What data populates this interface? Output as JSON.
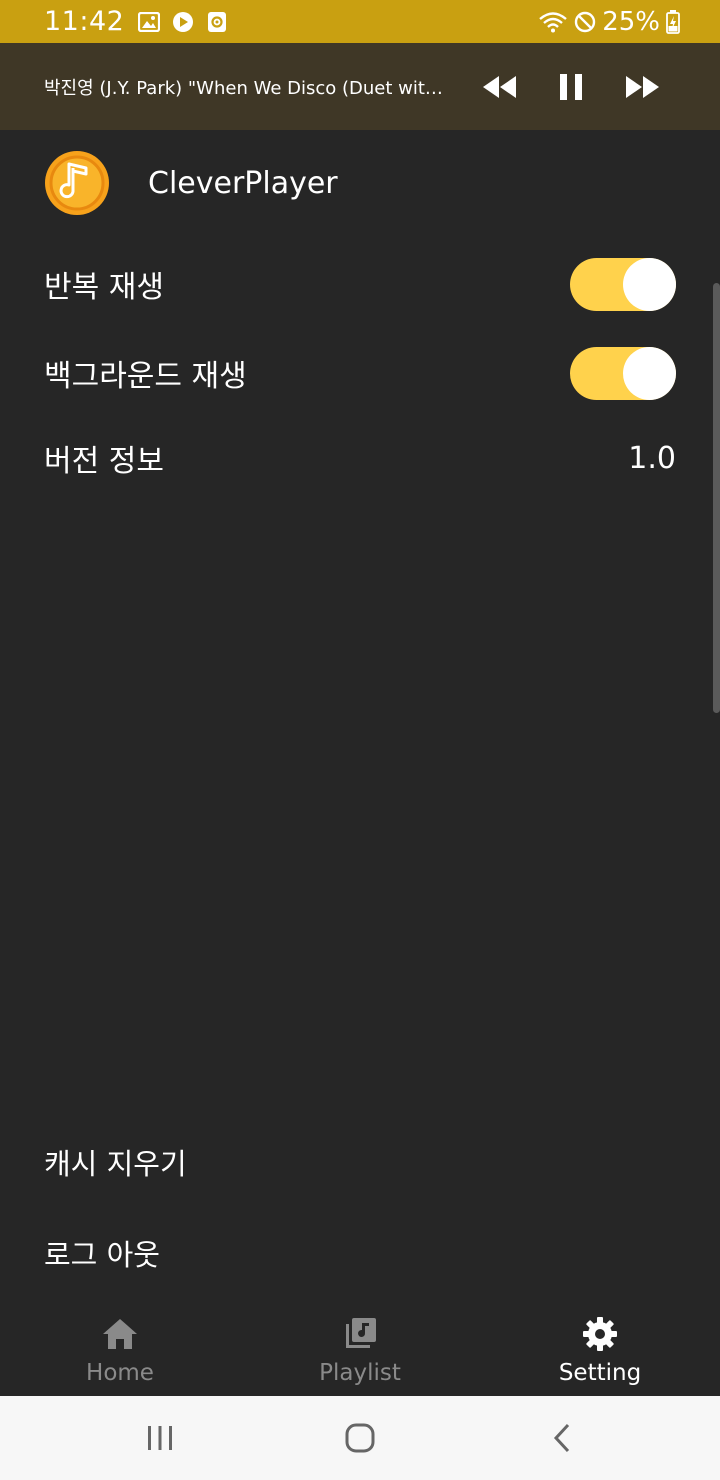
{
  "status_bar": {
    "time": "11:42",
    "battery_text": "25%",
    "background": "#c9a011"
  },
  "now_playing": {
    "title": "박진영 (J.Y. Park) \"When We Disco (Duet with Sunmi)\""
  },
  "header": {
    "app_name": "CleverPlayer"
  },
  "settings": {
    "repeat": {
      "label": "반복 재생",
      "on": true
    },
    "background_play": {
      "label": "백그라운드 재생",
      "on": true
    },
    "version": {
      "label": "버전 정보",
      "value": "1.0"
    }
  },
  "actions": {
    "clear_cache": "캐시 지우기",
    "logout": "로그 아웃"
  },
  "bottom_nav": {
    "home": "Home",
    "playlist": "Playlist",
    "setting": "Setting",
    "active": "setting"
  },
  "colors": {
    "accent": "#ffd24c",
    "background": "#262626",
    "now_playing_bg": "#3f3726",
    "inactive": "#8a8a8a"
  }
}
